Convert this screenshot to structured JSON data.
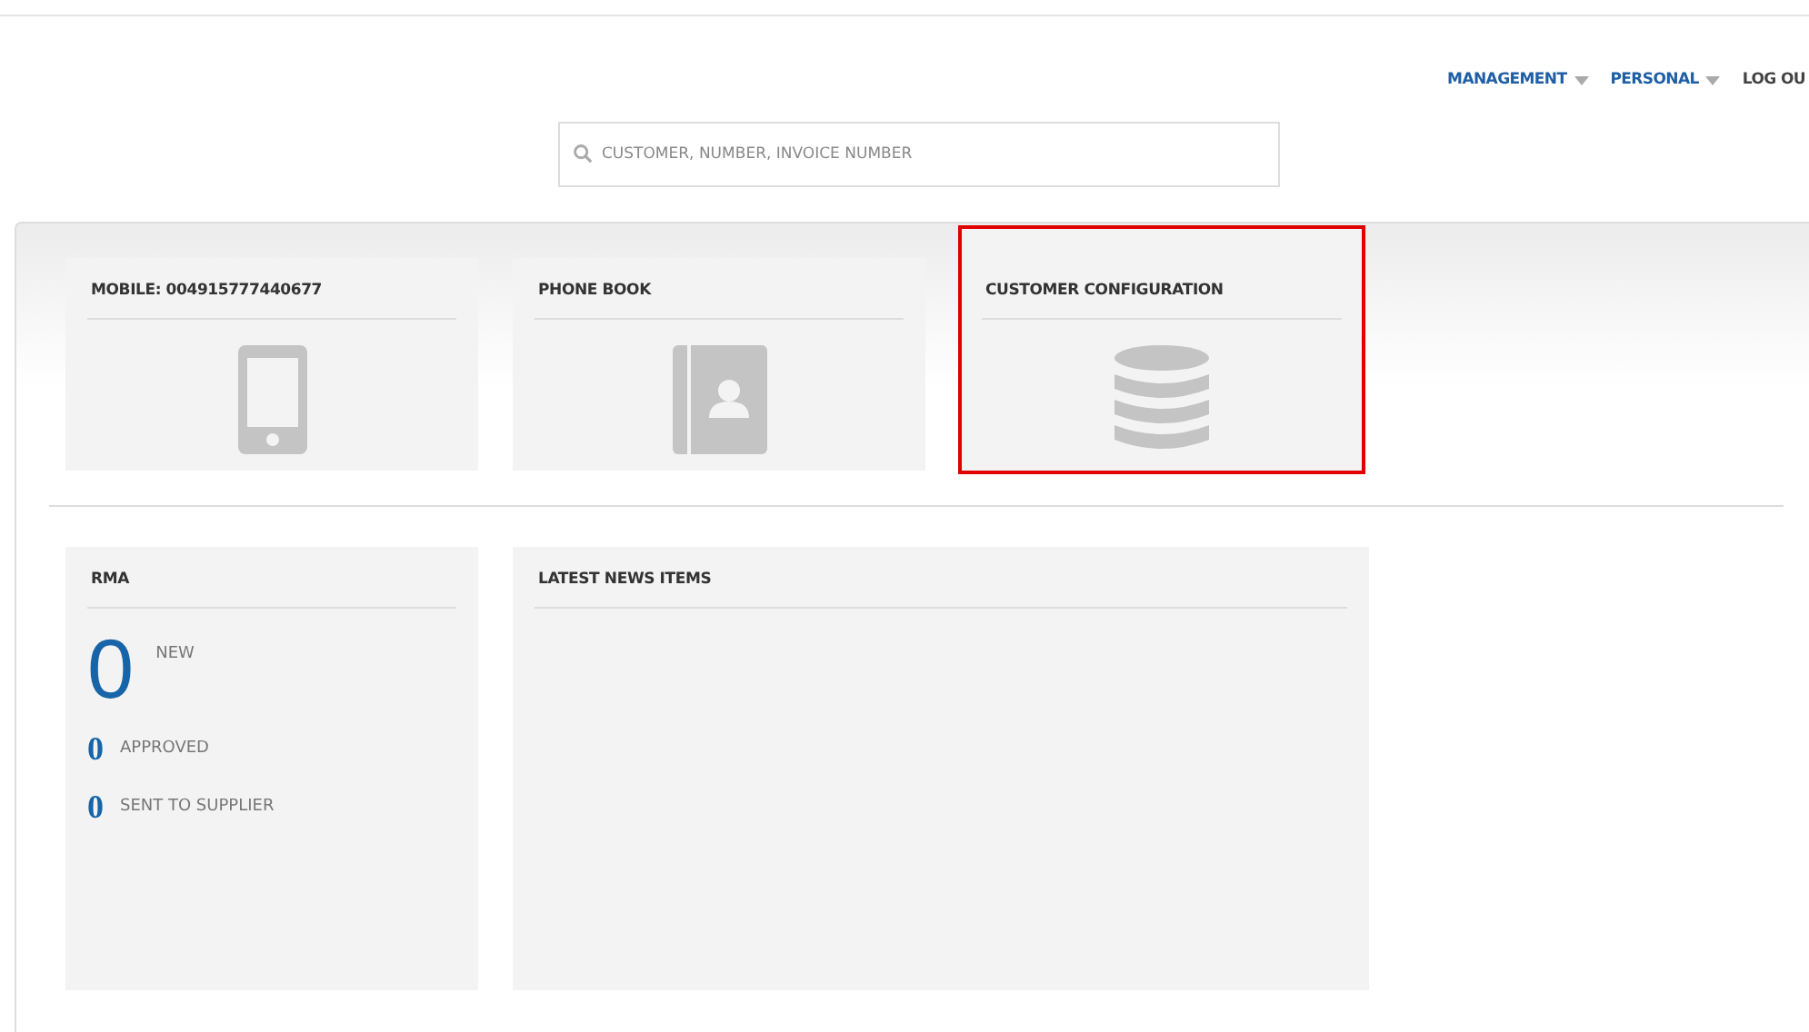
{
  "nav": [
    {
      "label": "MANAGEMENT",
      "kind": "menu"
    },
    {
      "label": "PERSONAL",
      "kind": "menu"
    },
    {
      "label": "LOG OU",
      "kind": "plain"
    }
  ],
  "search": {
    "placeholder": "CUSTOMER, NUMBER, INVOICE NUMBER"
  },
  "tiles": [
    {
      "title": "MOBILE: 004915777440677",
      "kind": "phone",
      "highlighted": false
    },
    {
      "title": "PHONE BOOK",
      "kind": "contacts",
      "highlighted": false
    },
    {
      "title": "CUSTOMER CONFIGURATION",
      "kind": "database",
      "highlighted": true
    }
  ],
  "rma": {
    "title": "RMA",
    "main": {
      "count": "0",
      "label": "NEW"
    },
    "stats": [
      {
        "count": "0",
        "label": "APPROVED"
      },
      {
        "count": "0",
        "label": "SENT TO SUPPLIER"
      }
    ]
  },
  "news": {
    "title": "LATEST NEWS ITEMS"
  }
}
